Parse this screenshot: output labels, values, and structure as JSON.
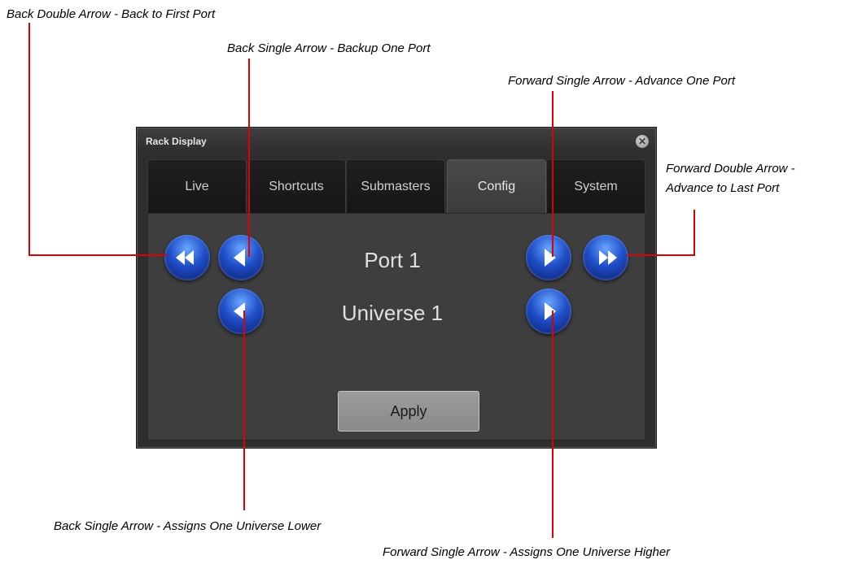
{
  "window": {
    "title": "Rack Display",
    "close_glyph": "✕"
  },
  "tabs": [
    {
      "label": "Live"
    },
    {
      "label": "Shortcuts"
    },
    {
      "label": "Submasters"
    },
    {
      "label": "Config",
      "active": true
    },
    {
      "label": "System"
    }
  ],
  "config": {
    "port_label": "Port 1",
    "universe_label": "Universe 1",
    "apply_label": "Apply"
  },
  "callouts": {
    "back_double_port": "Back Double Arrow - Back to First Port",
    "back_single_port": "Back Single Arrow - Backup One Port",
    "forward_single_port": "Forward Single Arrow - Advance One Port",
    "forward_double_port_line1": "Forward Double Arrow -",
    "forward_double_port_line2": "Advance to Last Port",
    "back_single_universe": "Back Single Arrow - Assigns One Universe Lower",
    "forward_single_universe": "Forward Single Arrow - Assigns One Universe Higher"
  },
  "colors": {
    "callout_line": "#e00000",
    "button_blue": "#1f4fc9",
    "window_bg": "#2e2e2e"
  }
}
